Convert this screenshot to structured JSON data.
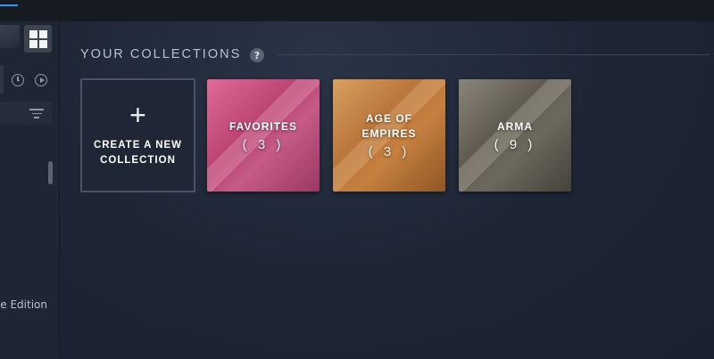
{
  "sidebar": {
    "partial_item_text": "ve Edition",
    "icons": [
      "grid-view-icon",
      "clock-icon",
      "play-icon",
      "filter-icon"
    ]
  },
  "main": {
    "section_title": "YOUR COLLECTIONS",
    "help_label": "?",
    "create_tile": {
      "plus": "+",
      "label": "CREATE A NEW COLLECTION"
    },
    "collections": [
      {
        "name": "FAVORITES",
        "count": "( 3 )",
        "color": "#c04a78"
      },
      {
        "name": "AGE OF EMPIRES",
        "count": "( 3 )",
        "color": "#b8743a"
      },
      {
        "name": "ARMA",
        "count": "( 9 )",
        "color": "#5f5b51"
      }
    ]
  },
  "colors": {
    "accent": "#1a9fff",
    "background": "#1b2230"
  }
}
